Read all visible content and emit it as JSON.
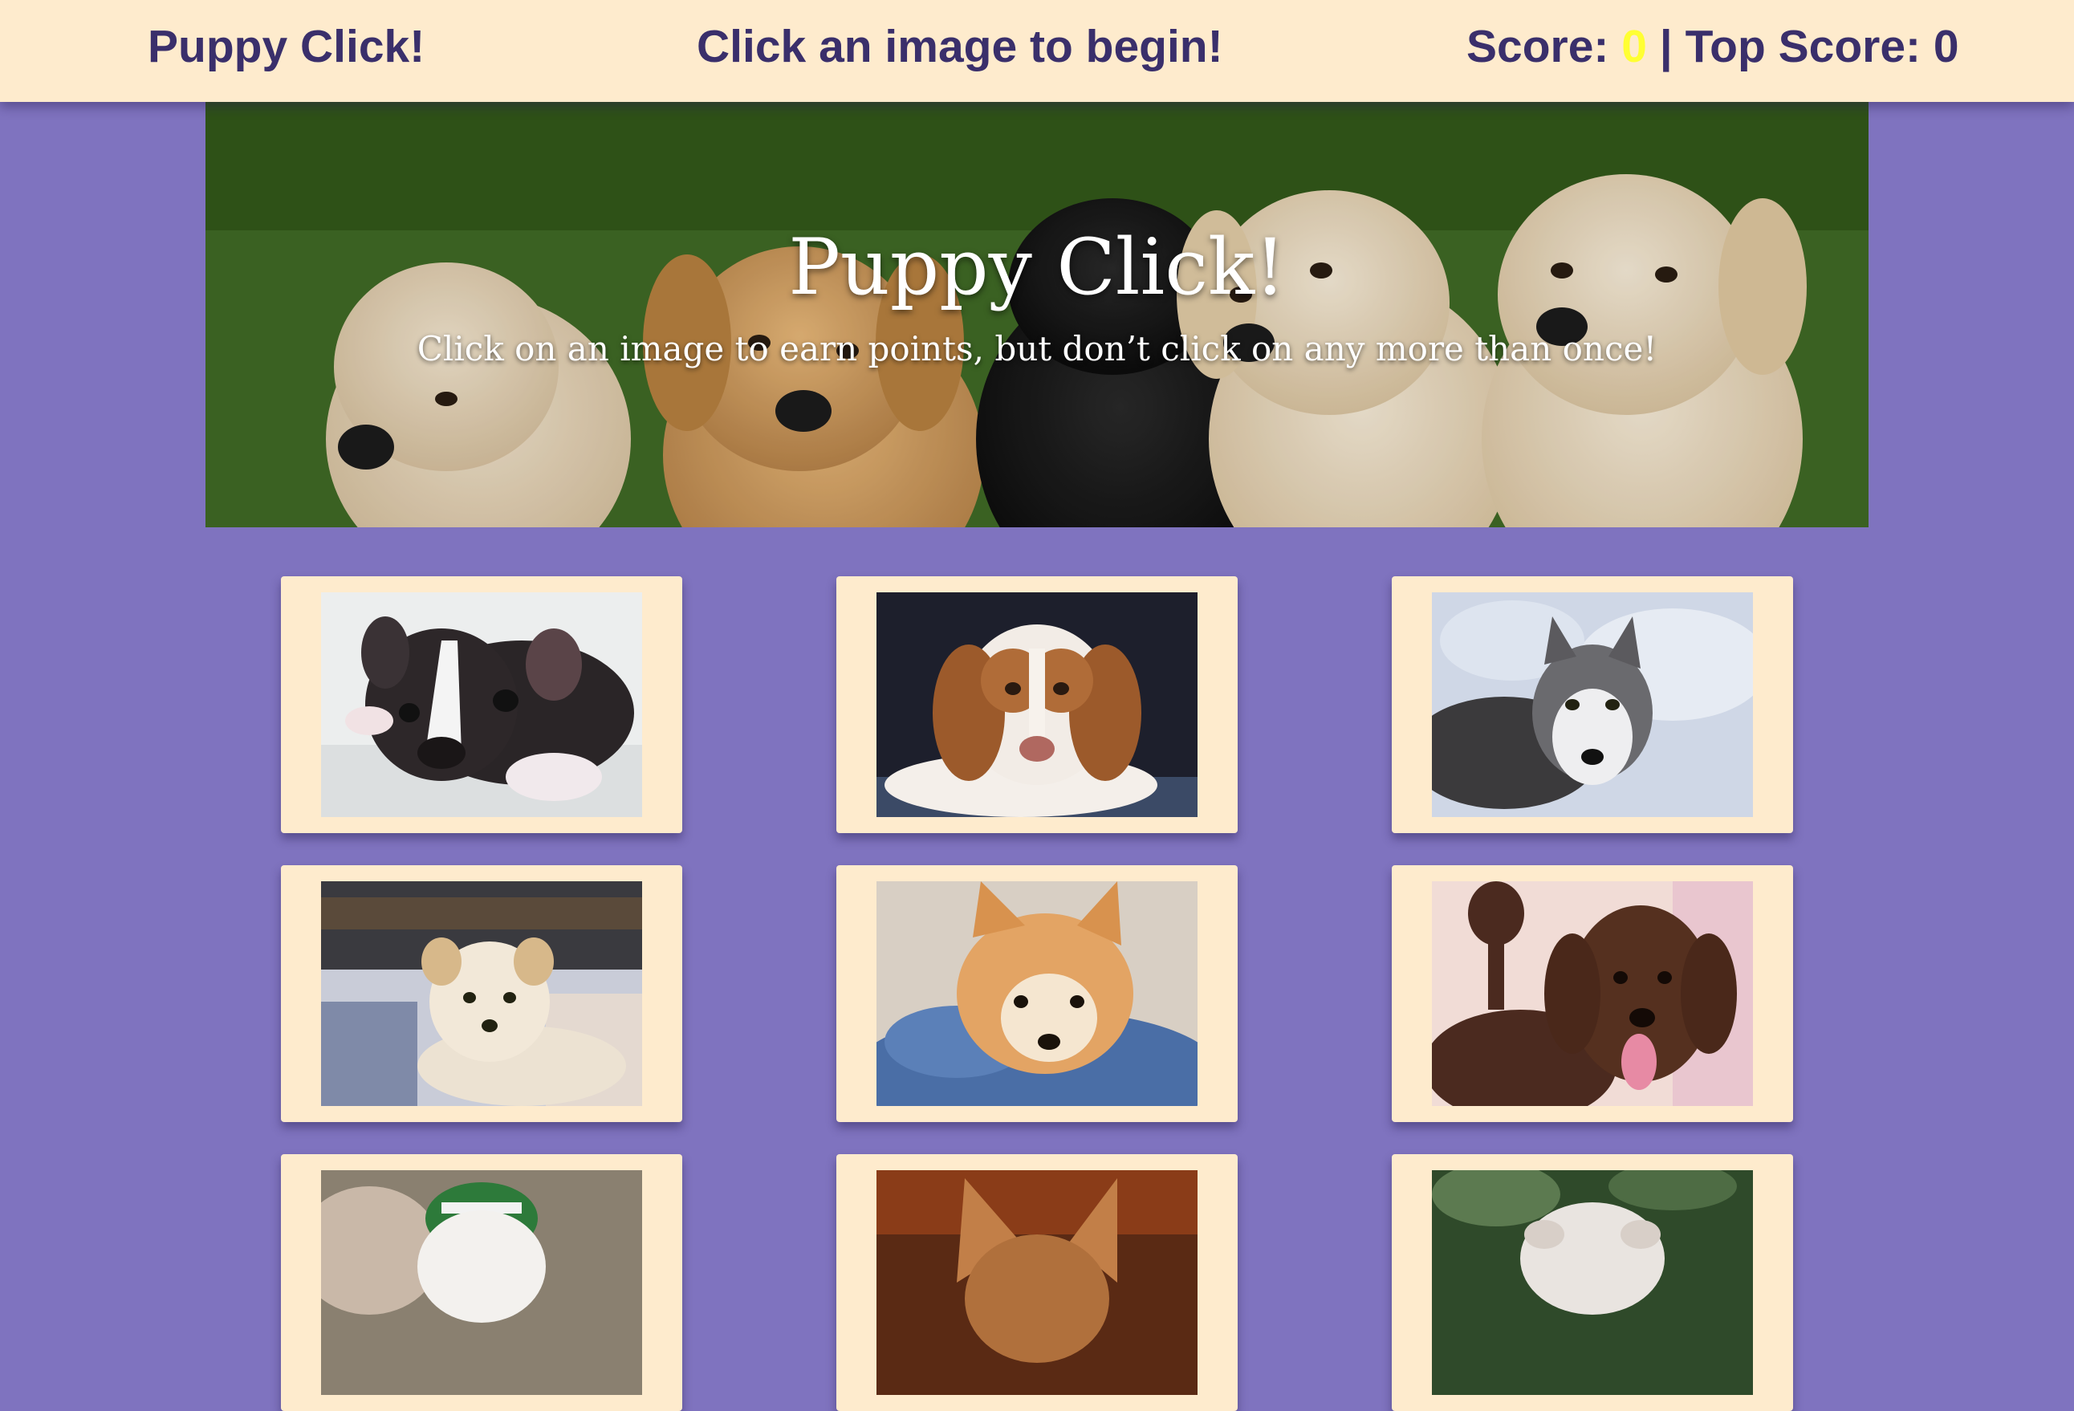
{
  "navbar": {
    "brand": "Puppy Click!",
    "message": "Click an image to begin!",
    "score_label": "Score: ",
    "score_value": "0",
    "separator": " | ",
    "top_score_label": "Top Score: ",
    "top_score_value": "0"
  },
  "hero": {
    "title": "Puppy Click!",
    "subtitle": "Click on an image to earn points, but don’t click on any more than once!"
  },
  "colors": {
    "page_background": "#7f73bf",
    "navbar_background": "#feebcd",
    "navbar_text": "#3a2f6b",
    "score_highlight": "#ffff33",
    "card_background": "#feebcd"
  },
  "cards": [
    {
      "image": "boston-terrier-puppy"
    },
    {
      "image": "beagle-puppy"
    },
    {
      "image": "husky-in-snow"
    },
    {
      "image": "yorkie-on-bed"
    },
    {
      "image": "pomeranian-on-pillow"
    },
    {
      "image": "brown-poodle"
    },
    {
      "image": "dog-with-green-hat"
    },
    {
      "image": "chihuahua"
    },
    {
      "image": "bulldog"
    }
  ]
}
